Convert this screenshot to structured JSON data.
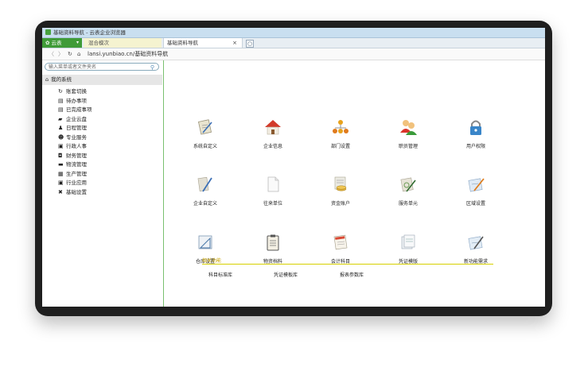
{
  "window": {
    "title": "基础资料导航 - 云表企业浏览器"
  },
  "tabs": {
    "home": "云表",
    "recent": "混合模次",
    "active": "基础资料导航",
    "close_symbol": "×",
    "new_symbol": "○"
  },
  "address": {
    "url": "lansi.yunbiao.cn/基础资料导航"
  },
  "sidebar": {
    "search_placeholder": "输入菜单或者文件夹名",
    "section_title": "我的系统",
    "items": [
      {
        "label": "账套切换",
        "icon": "refresh-icon"
      },
      {
        "label": "待办事项",
        "icon": "list-icon"
      },
      {
        "label": "已完成事项",
        "icon": "list-icon"
      },
      {
        "label": "企业云盘",
        "icon": "folder-icon"
      },
      {
        "label": "日程管理",
        "icon": "calendar-icon"
      },
      {
        "label": "专业服务",
        "icon": "person-icon"
      },
      {
        "label": "行政人事",
        "icon": "book-icon"
      },
      {
        "label": "财务管理",
        "icon": "money-icon"
      },
      {
        "label": "物流管理",
        "icon": "box-icon"
      },
      {
        "label": "生产管理",
        "icon": "factory-icon"
      },
      {
        "label": "行业应用",
        "icon": "app-icon"
      },
      {
        "label": "基础设置",
        "icon": "tools-icon"
      }
    ]
  },
  "modules": [
    {
      "label": "系统自定义",
      "icon": "doc-pen-icon"
    },
    {
      "label": "企业信息",
      "icon": "house-icon"
    },
    {
      "label": "部门设置",
      "icon": "org-icon"
    },
    {
      "label": "职员管理",
      "icon": "users-icon"
    },
    {
      "label": "用户权限",
      "icon": "lock-icon"
    },
    {
      "label": "企业自定义",
      "icon": "pencil-icon"
    },
    {
      "label": "往来单位",
      "icon": "page-icon"
    },
    {
      "label": "资金账户",
      "icon": "coins-icon"
    },
    {
      "label": "服务单元",
      "icon": "doc-gear-icon"
    },
    {
      "label": "区域设置",
      "icon": "doc-edit-icon"
    },
    {
      "label": "仓库设置",
      "icon": "ruler-icon"
    },
    {
      "label": "物资档料",
      "icon": "clipboard-icon"
    },
    {
      "label": "会计科目",
      "icon": "ledger-icon"
    },
    {
      "label": "凭证模版",
      "icon": "voucher-icon"
    },
    {
      "label": "新功能需求",
      "icon": "doc-write-icon"
    }
  ],
  "related": {
    "title": "相关功能",
    "links": [
      "科目标准库",
      "凭证模板库",
      "报表参数库"
    ]
  },
  "colors": {
    "accent_green": "#3f9b37",
    "divider_yellow": "#d7d000",
    "title_yellow": "#c8a400"
  }
}
